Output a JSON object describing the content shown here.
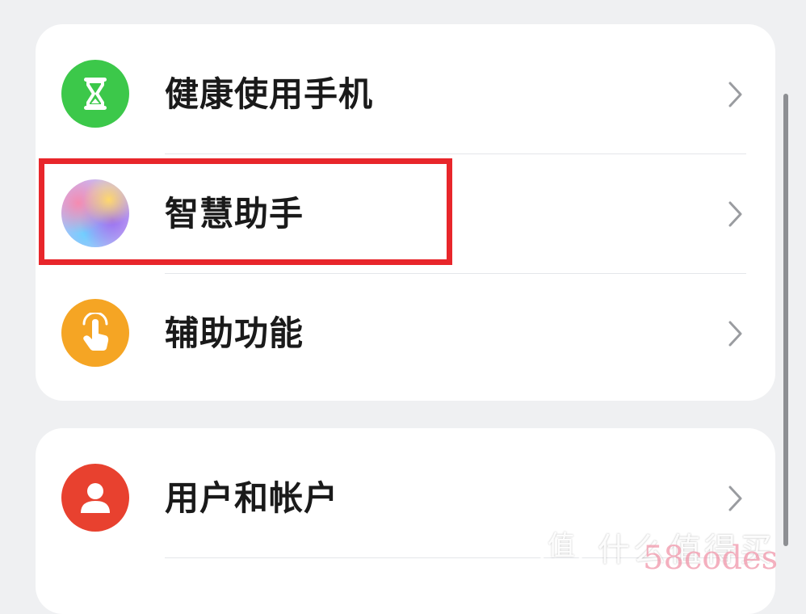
{
  "settings": {
    "group1": [
      {
        "label": "健康使用手机",
        "icon": "hourglass-icon",
        "color": "#3cc84a"
      },
      {
        "label": "智慧助手",
        "icon": "assistant-orb-icon",
        "color": "#b98be8"
      },
      {
        "label": "辅助功能",
        "icon": "hand-tap-icon",
        "color": "#f5a524"
      }
    ],
    "group2": [
      {
        "label": "用户和帐户",
        "icon": "user-icon",
        "color": "#e8412f"
      }
    ]
  },
  "highlight_color": "#e8262b",
  "watermark": {
    "circle": "值",
    "text": "什么值得买",
    "url": "58codes"
  }
}
